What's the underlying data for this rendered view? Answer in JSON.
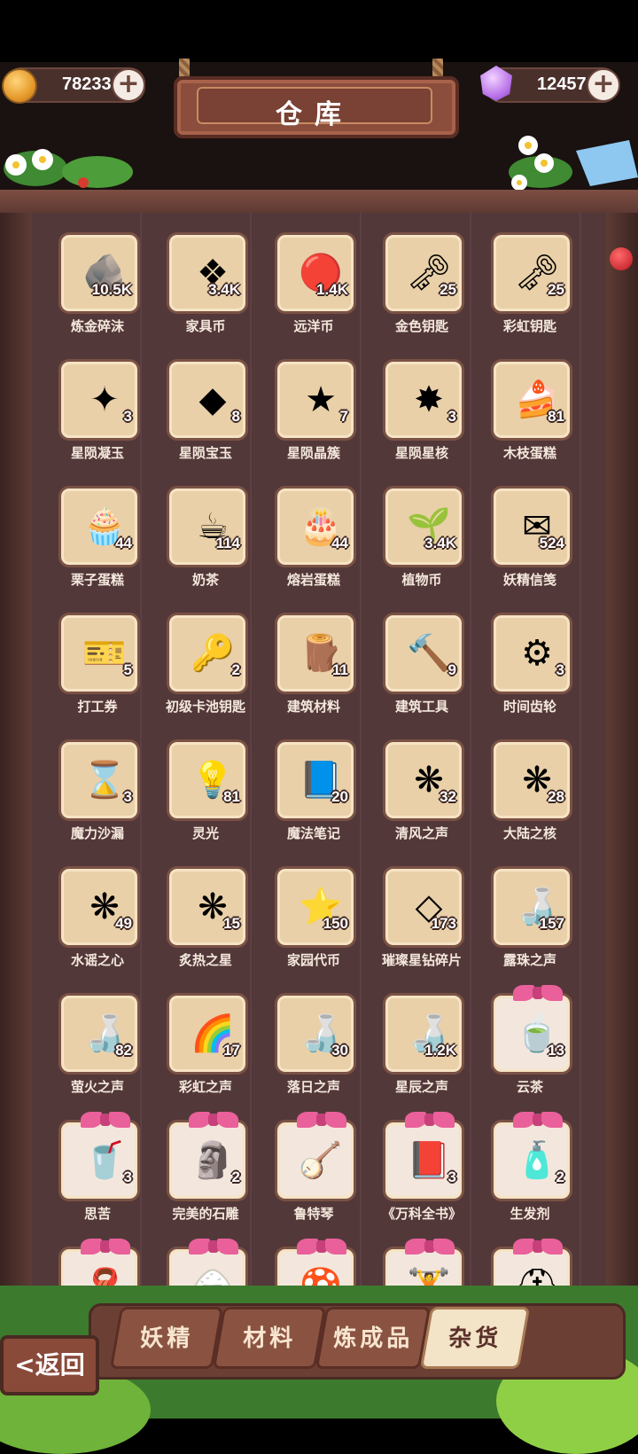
{
  "header": {
    "title": "仓库",
    "gold": "78233",
    "gems": "12457",
    "plus_symbol": "+"
  },
  "items": [
    {
      "name": "炼金碎沫",
      "count": "10.5K",
      "icon": "rock-icon",
      "glyph": "🪨",
      "gift": false
    },
    {
      "name": "家具币",
      "count": "3.4K",
      "icon": "furniture-coin-icon",
      "glyph": "❖",
      "gift": false
    },
    {
      "name": "远洋币",
      "count": "1.4K",
      "icon": "ocean-coin-icon",
      "glyph": "🔴",
      "gift": false
    },
    {
      "name": "金色钥匙",
      "count": "25",
      "icon": "gold-key-icon",
      "glyph": "🗝",
      "gift": false
    },
    {
      "name": "彩虹钥匙",
      "count": "25",
      "icon": "rainbow-key-icon",
      "glyph": "🗝",
      "gift": false
    },
    {
      "name": "星陨凝玉",
      "count": "3",
      "icon": "star-jade-icon",
      "glyph": "✦",
      "gift": false
    },
    {
      "name": "星陨宝玉",
      "count": "8",
      "icon": "star-gem-icon",
      "glyph": "◆",
      "gift": false
    },
    {
      "name": "星陨晶簇",
      "count": "7",
      "icon": "star-cluster-icon",
      "glyph": "★",
      "gift": false
    },
    {
      "name": "星陨星核",
      "count": "3",
      "icon": "star-core-icon",
      "glyph": "✸",
      "gift": false
    },
    {
      "name": "木枝蛋糕",
      "count": "81",
      "icon": "log-cake-icon",
      "glyph": "🍰",
      "gift": false
    },
    {
      "name": "栗子蛋糕",
      "count": "44",
      "icon": "chestnut-cake-icon",
      "glyph": "🧁",
      "gift": false
    },
    {
      "name": "奶茶",
      "count": "114",
      "icon": "milk-tea-icon",
      "glyph": "☕",
      "gift": false
    },
    {
      "name": "熔岩蛋糕",
      "count": "44",
      "icon": "lava-cake-icon",
      "glyph": "🎂",
      "gift": false
    },
    {
      "name": "植物币",
      "count": "3.4K",
      "icon": "plant-coin-icon",
      "glyph": "🌱",
      "gift": false
    },
    {
      "name": "妖精信笺",
      "count": "524",
      "icon": "fairy-letter-icon",
      "glyph": "✉",
      "gift": false
    },
    {
      "name": "打工券",
      "count": "5",
      "icon": "work-ticket-icon",
      "glyph": "🎫",
      "gift": false
    },
    {
      "name": "初级卡池钥匙",
      "count": "2",
      "icon": "bronze-key-icon",
      "glyph": "🔑",
      "gift": false
    },
    {
      "name": "建筑材料",
      "count": "11",
      "icon": "building-material-icon",
      "glyph": "🪵",
      "gift": false
    },
    {
      "name": "建筑工具",
      "count": "9",
      "icon": "hammer-icon",
      "glyph": "🔨",
      "gift": false
    },
    {
      "name": "时间齿轮",
      "count": "3",
      "icon": "gear-icon",
      "glyph": "⚙",
      "gift": false
    },
    {
      "name": "魔力沙漏",
      "count": "3",
      "icon": "hourglass-icon",
      "glyph": "⌛",
      "gift": false
    },
    {
      "name": "灵光",
      "count": "81",
      "icon": "inspiration-icon",
      "glyph": "💡",
      "gift": false
    },
    {
      "name": "魔法笔记",
      "count": "20",
      "icon": "magic-notebook-icon",
      "glyph": "📘",
      "gift": false
    },
    {
      "name": "清风之声",
      "count": "32",
      "icon": "wind-crystal-icon",
      "glyph": "❋",
      "gift": false
    },
    {
      "name": "大陆之核",
      "count": "28",
      "icon": "earth-crystal-icon",
      "glyph": "❋",
      "gift": false
    },
    {
      "name": "水谣之心",
      "count": "49",
      "icon": "water-crystal-icon",
      "glyph": "❋",
      "gift": false
    },
    {
      "name": "炙热之星",
      "count": "15",
      "icon": "fire-crystal-icon",
      "glyph": "❋",
      "gift": false
    },
    {
      "name": "家园代币",
      "count": "150",
      "icon": "home-token-icon",
      "glyph": "⭐",
      "gift": false
    },
    {
      "name": "璀璨星钻碎片",
      "count": "173",
      "icon": "diamond-shard-icon",
      "glyph": "◇",
      "gift": false
    },
    {
      "name": "露珠之声",
      "count": "157",
      "icon": "dew-bottle-icon",
      "glyph": "🍶",
      "gift": false
    },
    {
      "name": "萤火之声",
      "count": "82",
      "icon": "firefly-bottle-icon",
      "glyph": "🍶",
      "gift": false
    },
    {
      "name": "彩虹之声",
      "count": "17",
      "icon": "rainbow-bottle-icon",
      "glyph": "🌈",
      "gift": false
    },
    {
      "name": "落日之声",
      "count": "30",
      "icon": "sunset-bottle-icon",
      "glyph": "🍶",
      "gift": false
    },
    {
      "name": "星辰之声",
      "count": "1.2K",
      "icon": "starry-bottle-icon",
      "glyph": "🍶",
      "gift": false
    },
    {
      "name": "云茶",
      "count": "13",
      "icon": "tea-bowl-icon",
      "glyph": "🍵",
      "gift": true
    },
    {
      "name": "思苦",
      "count": "3",
      "icon": "bitter-cup-icon",
      "glyph": "🥤",
      "gift": true
    },
    {
      "name": "完美的石雕",
      "count": "2",
      "icon": "statue-icon",
      "glyph": "🗿",
      "gift": true
    },
    {
      "name": "鲁特琴",
      "count": "",
      "icon": "lute-icon",
      "glyph": "🪕",
      "gift": true
    },
    {
      "name": "《万科全书》",
      "count": "3",
      "icon": "encyclopedia-icon",
      "glyph": "📕",
      "gift": true
    },
    {
      "name": "生发剂",
      "count": "2",
      "icon": "tonic-bottle-icon",
      "glyph": "🧴",
      "gift": true
    },
    {
      "name": "",
      "count": "",
      "icon": "scarf-bottle-icon",
      "glyph": "🧣",
      "gift": true
    },
    {
      "name": "",
      "count": "",
      "icon": "rice-ball-icon",
      "glyph": "🍙",
      "gift": true
    },
    {
      "name": "",
      "count": "",
      "icon": "mushroom-icon",
      "glyph": "🍄",
      "gift": true
    },
    {
      "name": "",
      "count": "",
      "icon": "dumbbell-icon",
      "glyph": "🏋",
      "gift": true
    },
    {
      "name": "",
      "count": "",
      "icon": "helmet-icon",
      "glyph": "⛑",
      "gift": true
    }
  ],
  "tabs": [
    {
      "label": "妖精",
      "active": false
    },
    {
      "label": "材料",
      "active": false
    },
    {
      "label": "炼成品",
      "active": false
    },
    {
      "label": "杂货",
      "active": true
    }
  ],
  "back_label": "<返回"
}
